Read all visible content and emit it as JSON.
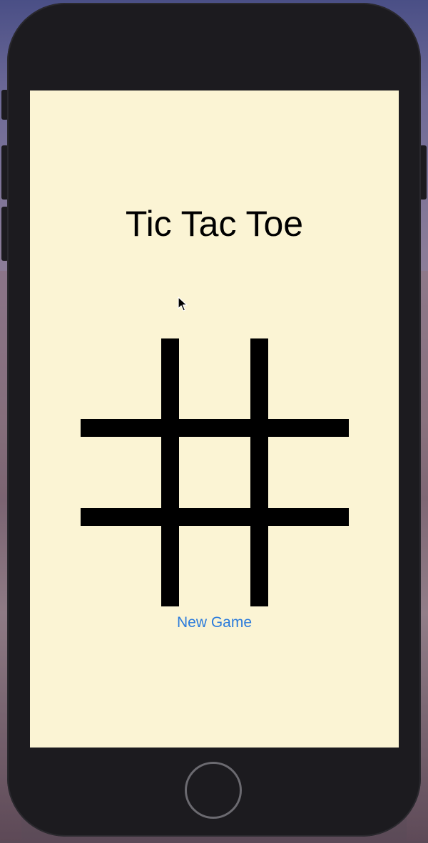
{
  "app": {
    "title": "Tic Tac Toe",
    "new_game_label": "New Game"
  },
  "board": {
    "cells": [
      "",
      "",
      "",
      "",
      "",
      "",
      "",
      "",
      ""
    ]
  },
  "colors": {
    "screen_background": "#fbf4d4",
    "grid_lines": "#000000",
    "link_blue": "#2b7bdb",
    "device_body": "#1c1b1f"
  },
  "icons": {
    "cursor": "arrow-cursor-icon",
    "home": "home-button-icon"
  }
}
